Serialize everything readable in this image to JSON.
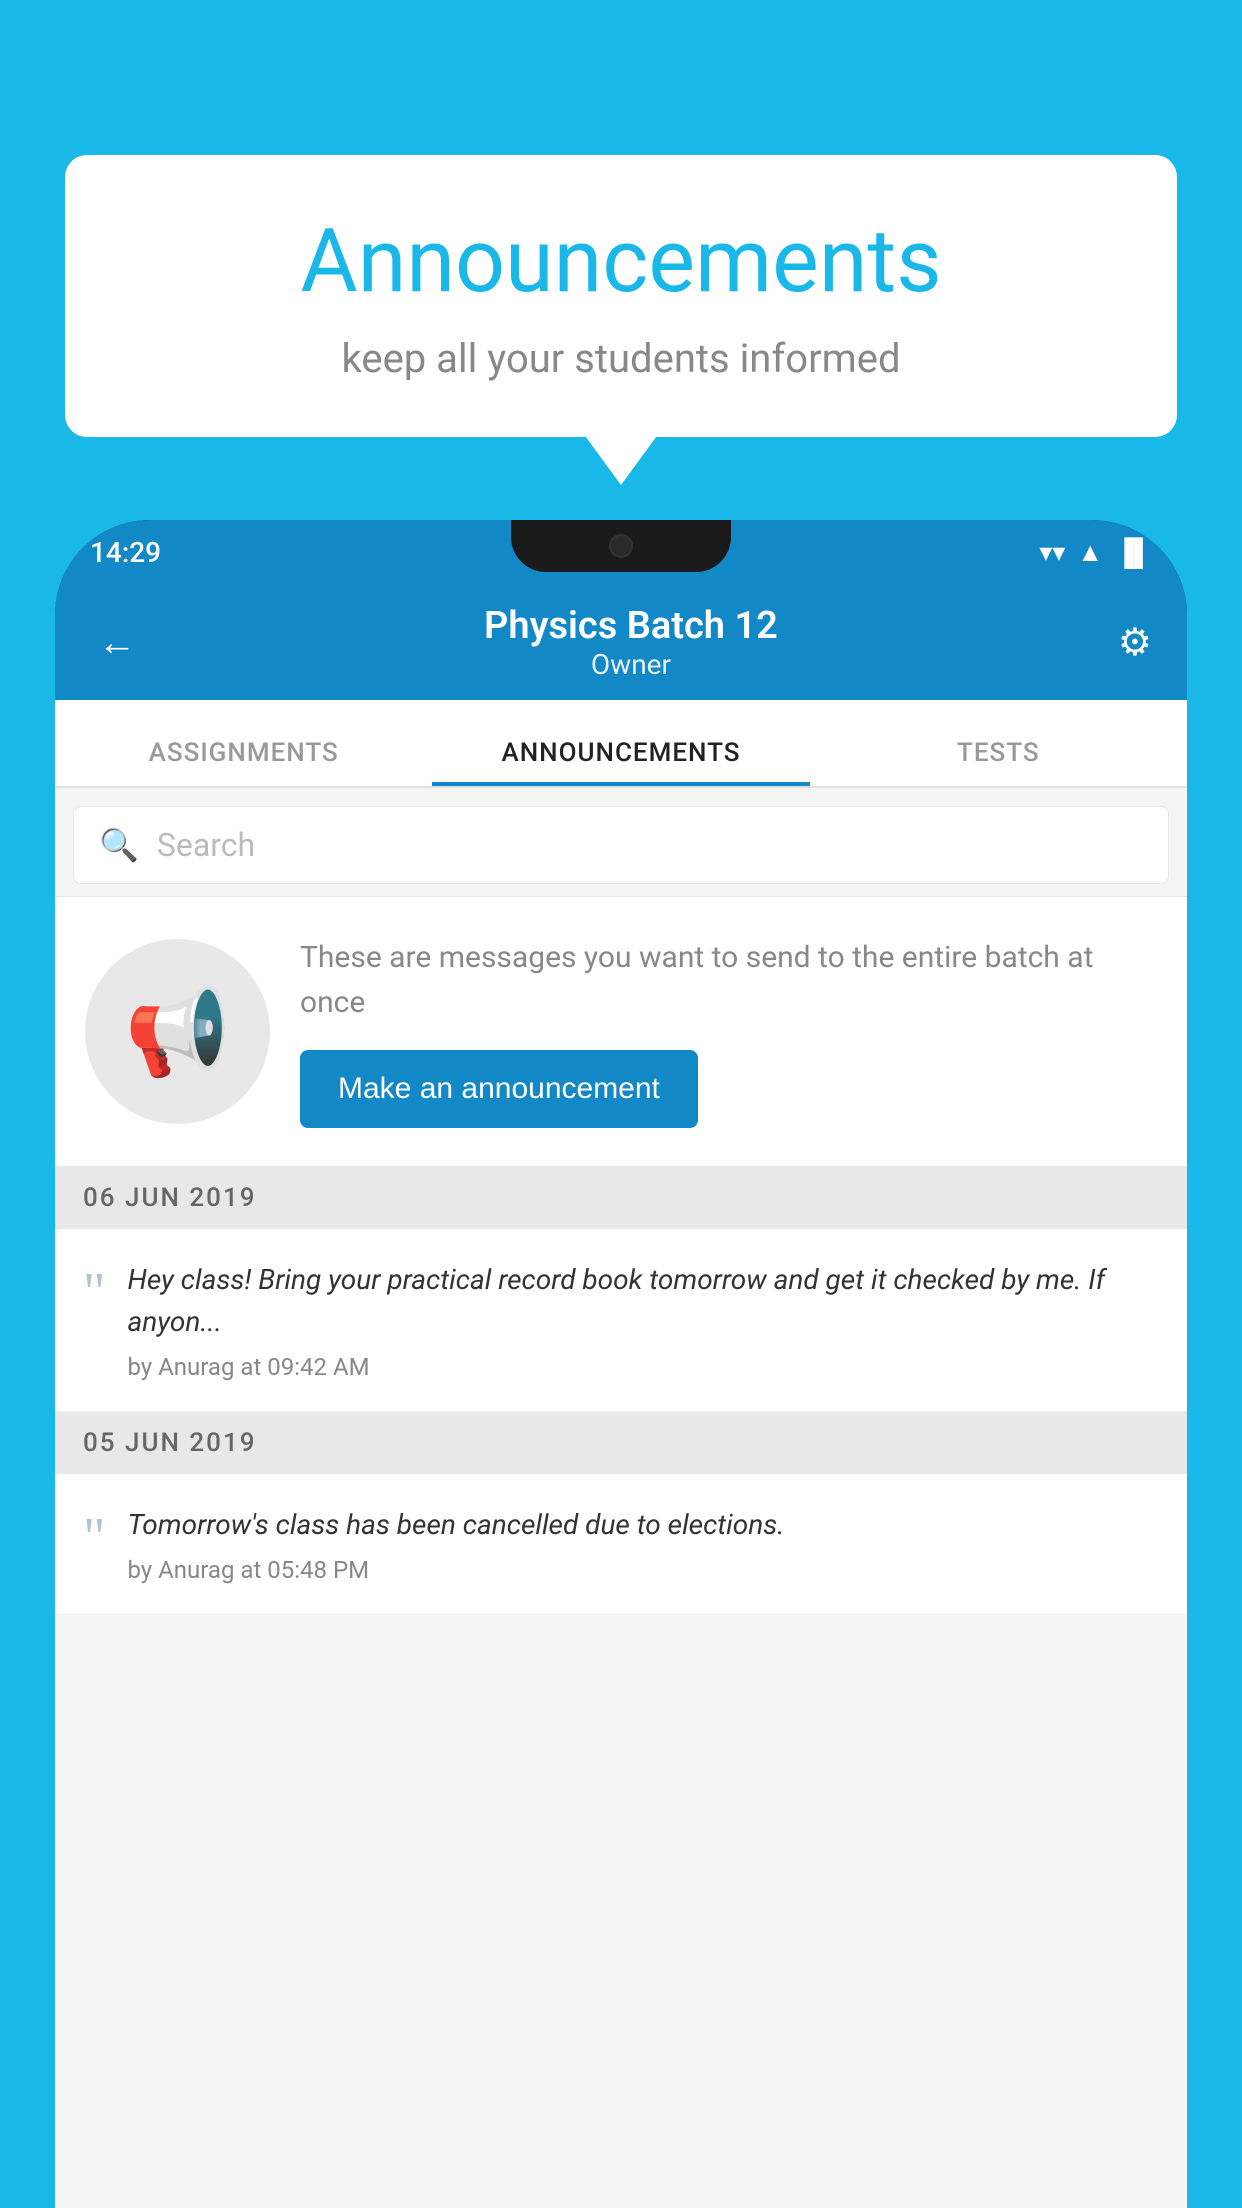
{
  "page": {
    "background_color": "#1ab8e8"
  },
  "speech_bubble": {
    "title": "Announcements",
    "subtitle": "keep all your students informed"
  },
  "status_bar": {
    "time": "14:29",
    "wifi_icon": "▼",
    "signal_icon": "▲",
    "battery_icon": "▐"
  },
  "header": {
    "back_label": "←",
    "title": "Physics Batch 12",
    "subtitle": "Owner",
    "settings_icon": "⚙"
  },
  "tabs": [
    {
      "label": "ASSIGNMENTS",
      "active": false
    },
    {
      "label": "ANNOUNCEMENTS",
      "active": true
    },
    {
      "label": "TESTS",
      "active": false
    }
  ],
  "search": {
    "placeholder": "Search"
  },
  "promo": {
    "description": "These are messages you want to send to the entire batch at once",
    "button_label": "Make an announcement"
  },
  "announcements": [
    {
      "date": "06  JUN  2019",
      "items": [
        {
          "message": "Hey class! Bring your practical record book tomorrow and get it checked by me. If anyon...",
          "author": "by Anurag at 09:42 AM"
        }
      ]
    },
    {
      "date": "05  JUN  2019",
      "items": [
        {
          "message": "Tomorrow's class has been cancelled due to elections.",
          "author": "by Anurag at 05:48 PM"
        }
      ]
    }
  ]
}
